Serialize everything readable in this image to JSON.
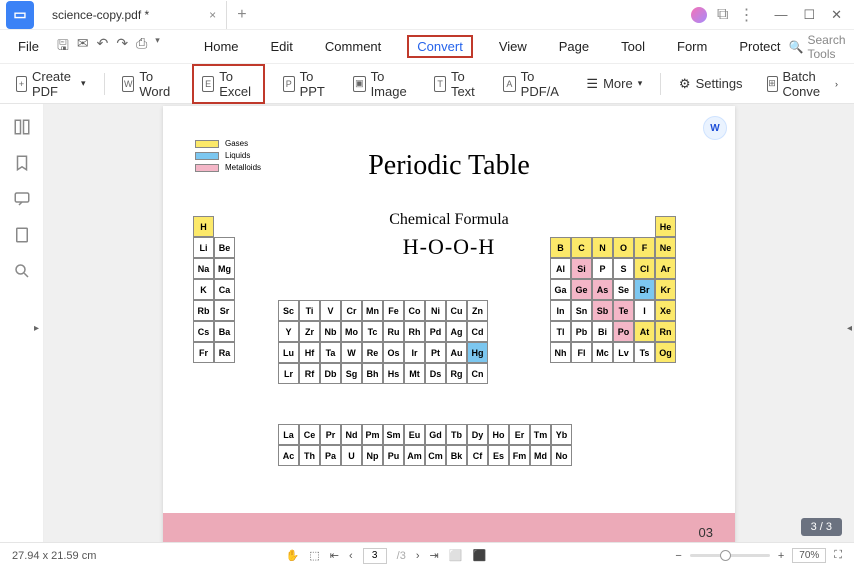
{
  "window": {
    "tab_title": "science-copy.pdf *"
  },
  "menu": {
    "file": "File",
    "tabs": [
      "Home",
      "Edit",
      "Comment",
      "Convert",
      "View",
      "Page",
      "Tool",
      "Form",
      "Protect"
    ],
    "active_tab": "Convert",
    "search_placeholder": "Search Tools"
  },
  "toolbar": {
    "create_pdf": "Create PDF",
    "to_word": "To Word",
    "to_excel": "To Excel",
    "to_ppt": "To PPT",
    "to_image": "To Image",
    "to_text": "To Text",
    "to_pdfa": "To PDF/A",
    "more": "More",
    "settings": "Settings",
    "batch": "Batch Conve"
  },
  "doc": {
    "title": "Periodic Table",
    "subtitle": "Chemical Formula",
    "formula": "H-O-O-H",
    "legend": {
      "gases": "Gases",
      "liquids": "Liquids",
      "metalloids": "Metalloids"
    },
    "page_number": "03",
    "page_badge": "3 / 3",
    "elements": {
      "block1": [
        [
          "H",
          ""
        ],
        [
          "Li",
          "Be"
        ],
        [
          "Na",
          "Mg"
        ],
        [
          "K",
          "Ca"
        ],
        [
          "Rb",
          "Sr"
        ],
        [
          "Cs",
          "Ba"
        ],
        [
          "Fr",
          "Ra"
        ]
      ],
      "block2": [
        [
          "Sc",
          "Ti",
          "V",
          "Cr",
          "Mn",
          "Fe",
          "Co",
          "Ni",
          "Cu",
          "Zn"
        ],
        [
          "Y",
          "Zr",
          "Nb",
          "Mo",
          "Tc",
          "Ru",
          "Rh",
          "Pd",
          "Ag",
          "Cd"
        ],
        [
          "Lu",
          "Hf",
          "Ta",
          "W",
          "Re",
          "Os",
          "Ir",
          "Pt",
          "Au",
          "Hg"
        ],
        [
          "Lr",
          "Rf",
          "Db",
          "Sg",
          "Bh",
          "Hs",
          "Mt",
          "Ds",
          "Rg",
          "Cn"
        ]
      ],
      "block3": [
        [
          "",
          "",
          "",
          "",
          "",
          "He"
        ],
        [
          "B",
          "C",
          "N",
          "O",
          "F",
          "Ne"
        ],
        [
          "Al",
          "Si",
          "P",
          "S",
          "Cl",
          "Ar"
        ],
        [
          "Ga",
          "Ge",
          "As",
          "Se",
          "Br",
          "Kr"
        ],
        [
          "In",
          "Sn",
          "Sb",
          "Te",
          "I",
          "Xe"
        ],
        [
          "Tl",
          "Pb",
          "Bi",
          "Po",
          "At",
          "Rn"
        ],
        [
          "Nh",
          "Fl",
          "Mc",
          "Lv",
          "Ts",
          "Og"
        ]
      ],
      "lan": [
        [
          "La",
          "Ce",
          "Pr",
          "Nd",
          "Pm",
          "Sm",
          "Eu",
          "Gd",
          "Tb",
          "Dy",
          "Ho",
          "Er",
          "Tm",
          "Yb"
        ],
        [
          "Ac",
          "Th",
          "Pa",
          "U",
          "Np",
          "Pu",
          "Am",
          "Cm",
          "Bk",
          "Cf",
          "Es",
          "Fm",
          "Md",
          "No"
        ]
      ]
    }
  },
  "status": {
    "dims": "27.94 x 21.59 cm",
    "page_current": "3",
    "page_total": "/3",
    "zoom": "70%"
  },
  "colors": {
    "yellow": "#fce96a",
    "blue": "#7cc7f0",
    "pink": "#f4b6c7",
    "highlight_cells_yellow": [
      "H",
      "He",
      "B",
      "C",
      "N",
      "O",
      "F",
      "Ne",
      "Cl",
      "Ar",
      "Kr",
      "Xe",
      "At",
      "Rn",
      "Og"
    ],
    "highlight_cells_blue": [
      "Hg",
      "Br"
    ],
    "highlight_cells_pink": [
      "Si",
      "Ge",
      "As",
      "Sb",
      "Te",
      "Po"
    ]
  }
}
